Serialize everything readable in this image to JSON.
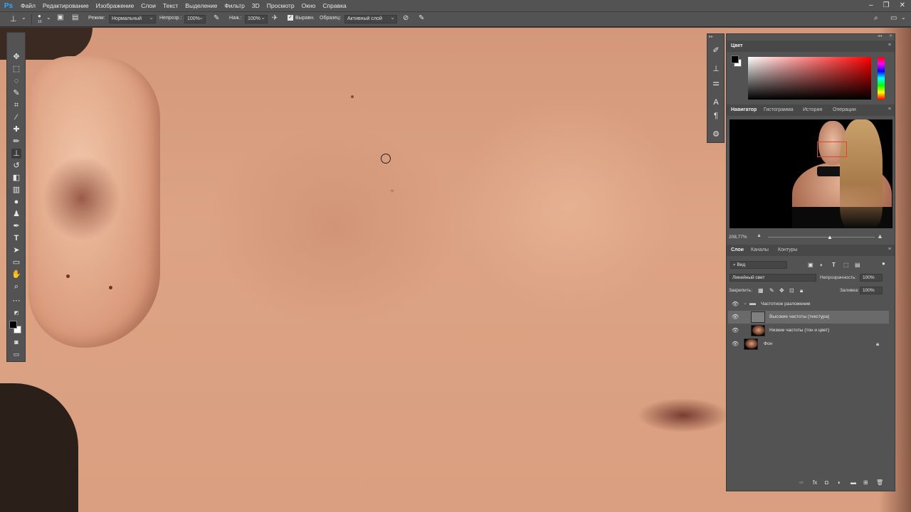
{
  "app": {
    "logo": "Ps"
  },
  "menu": [
    "Файл",
    "Редактирование",
    "Изображение",
    "Слои",
    "Текст",
    "Выделение",
    "Фильтр",
    "3D",
    "Просмотр",
    "Окно",
    "Справка"
  ],
  "options": {
    "brush_size": "10",
    "mode_label": "Режим:",
    "mode_value": "Нормальный",
    "opacity_label": "Непрозр.:",
    "opacity_value": "100%",
    "pressure_label": "Наж.:",
    "pressure_value": "100%",
    "aligned_label": "Выравн.",
    "sample_label": "Образец:",
    "sample_value": "Активный слой"
  },
  "panels": {
    "color_tab": "Цвет",
    "nav_tabs": [
      "Навигатор",
      "Гистограмма",
      "История",
      "Операции"
    ],
    "zoom": "208,77%",
    "layer_tabs": [
      "Слои",
      "Каналы",
      "Контуры"
    ],
    "filter_kind": "Вид",
    "blend_mode": "Линейный свет",
    "opacity_label": "Непрозрачность:",
    "opacity_value": "100%",
    "lock_label": "Закрепить:",
    "fill_label": "Заливка:",
    "fill_value": "100%",
    "layers": [
      {
        "name": "Частотное разложение",
        "kind": "group"
      },
      {
        "name": "Высокие частоты (текстура)",
        "kind": "gray",
        "selected": true
      },
      {
        "name": "Низкие частоты (тон и цвет)",
        "kind": "photo"
      },
      {
        "name": "Фон",
        "kind": "photo",
        "locked": true
      }
    ]
  },
  "colors": {
    "accent": "#31a8ff",
    "panel": "#535353",
    "foreground": "#000000",
    "background": "#ffffff"
  }
}
